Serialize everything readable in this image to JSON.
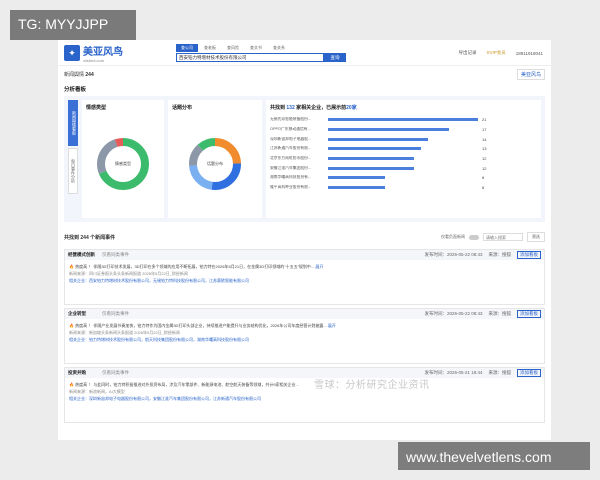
{
  "corner_tag": "TG: MYYJJPP",
  "corner_url": "www.thevelvetlens.com",
  "watermark": "雪球：分析研究企业资讯",
  "logo": {
    "name": "美亚风鸟",
    "sub": "viisbird.com"
  },
  "search": {
    "tabs": [
      "查公司",
      "查老板",
      "查风险",
      "查文书",
      "查关系"
    ],
    "value": "西安铂力特增材技术股份有限公司",
    "button": "查询"
  },
  "topnav": {
    "items": [
      "导出记录",
      "SVIP会员",
      "18911918041"
    ]
  },
  "subbar": {
    "label": "新闻舆情",
    "count": "244",
    "right_logo": "美亚风鸟"
  },
  "analysis": {
    "title": "分析看板",
    "side_tabs": [
      "新闻舆情看板",
      "每日事件分析"
    ],
    "panel1": {
      "title": "情感类型",
      "center": "情感类型"
    },
    "panel2": {
      "title": "话题分布",
      "center": "话题分布"
    },
    "panel3": {
      "prefix": "共找到",
      "count": "132",
      "mid": "家相关企业，已展示前",
      "shown": "20家",
      "rows": [
        {
          "label": "无锡先导智能装备股份...",
          "value": 21
        },
        {
          "label": "OPPO广东移动通信有...",
          "value": 17
        },
        {
          "label": "深圳新宙邦电子电器股...",
          "value": 14
        },
        {
          "label": "江苏新通汽车股份有限...",
          "value": 13
        },
        {
          "label": "北京东方雨虹防水股份...",
          "value": 12
        },
        {
          "label": "安徽江淮汽车集团股份...",
          "value": 12
        },
        {
          "label": "湖南华曙高科技股份有...",
          "value": 8
        },
        {
          "label": "隆平高科种业股份有限...",
          "value": 8
        }
      ]
    }
  },
  "list": {
    "title": "共找到 244 个新闻事件",
    "toggle": "仅看负面新闻",
    "search_placeholder": "请输入搜索",
    "filter": "筛选"
  },
  "cards": [
    {
      "cat": "经营模式创新",
      "tag": "仅看同类事件",
      "time": "发布时间：2026-05-22 08:43",
      "source": "来源：搜狐",
      "action": "添加看板",
      "line1": "热度高 ！ 伴随3D打印技术发展，3D打印在多个领域的应用不断拓展，铂力特在2026年5月21日，在金属3D打印领域的“十五五”规划中...",
      "more": "展开",
      "src_line": "新闻来源：四川证券报头条头条新闻报道 2026年5月22日_财经新闻",
      "rel_line": "相关企业：西安铂力特增材技术股份有限公司，无锡铂力特科技股份有限公司，江苏赛欧智能有限公司"
    },
    {
      "cat": "企业转型",
      "tag": "仅看同类事件",
      "time": "发布时间：2026-05-22 08:43",
      "source": "来源：搜狐",
      "action": "添加看板",
      "line1": "热度高 ！ 伴随产业发展节奏加快，铂力特作为国内金属3D打印头部企业，持续推进产能提升与业务结构优化，2026年公司年度经营计划披露...",
      "more": "展开",
      "src_line": "新闻来源：新加坡头条新闻头条报道 2026年5月22日_财经新闻",
      "rel_line": "相关企业：铂力特增材技术股份有限公司，航天科技集团股份有限公司，湖南华曙高科技股份有限公司"
    },
    {
      "cat": "投资并购",
      "tag": "仅看同类事件",
      "time": "发布时间：2026-05-21 18:44",
      "source": "来源：搜狐",
      "action": "添加看板",
      "line1": "热度高 ！ 与此同时，铂力特积极推进对外投资布局，涉及汽车零部件、新能源电池、航空航天装备等领域，共计9家相关企业...",
      "more": "",
      "src_line": "新闻来源：新浪新闻，AI大模型",
      "rel_line": "相关企业：深圳新宙邦电子电器股份有限公司，安徽江淮汽车集团股份有限公司，江苏新通汽车股份有限公司"
    }
  ]
}
